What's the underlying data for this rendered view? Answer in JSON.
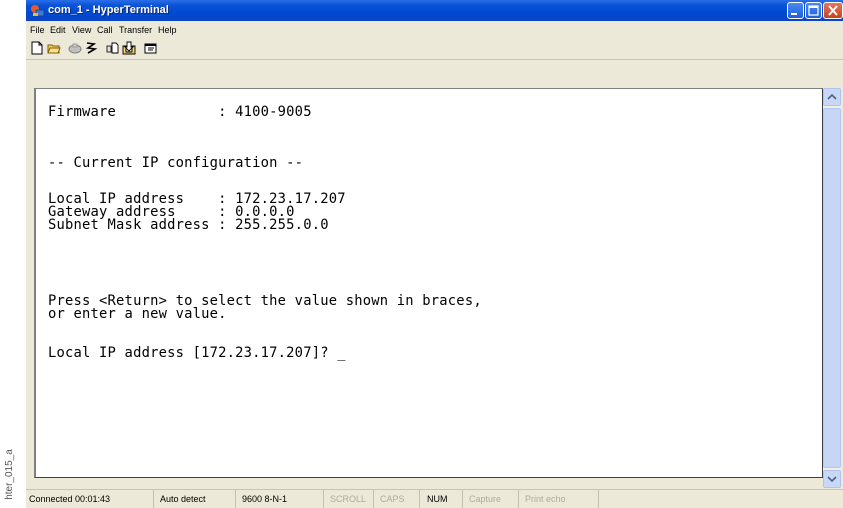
{
  "side_tag": "hter_015_a",
  "window": {
    "title": "com_1 - HyperTerminal"
  },
  "menu": [
    {
      "label": "File"
    },
    {
      "label": "Edit"
    },
    {
      "label": "View"
    },
    {
      "label": "Call"
    },
    {
      "label": "Transfer"
    },
    {
      "label": "Help"
    }
  ],
  "toolbar": {
    "icons": [
      "new-icon",
      "open-icon",
      "disconnect-icon",
      "dial-icon",
      "send-icon",
      "receive-icon",
      "properties-icon"
    ]
  },
  "terminal": {
    "lines": [
      "Firmware            : 4100-9005",
      "",
      "",
      "-- Current IP configuration --",
      "",
      "Local IP address    : 172.23.17.207",
      "Gateway address     : 0.0.0.0",
      "Subnet Mask address : 255.255.0.0",
      "",
      "",
      "",
      "",
      "Press <Return> to select the value shown in braces,",
      "or enter a new value.",
      "",
      "Local IP address [172.23.17.207]? _"
    ]
  },
  "statusbar": {
    "connected": "Connected 00:01:43",
    "detect": "Auto detect",
    "settings": "9600 8-N-1",
    "scroll": "SCROLL",
    "caps": "CAPS",
    "num": "NUM",
    "capture": "Capture",
    "print_echo": "Print echo"
  },
  "colors": {
    "title_bar": "#0049d3",
    "window_face": "#ece9d8",
    "terminal_bg": "#ffffff",
    "terminal_text": "#000000"
  }
}
